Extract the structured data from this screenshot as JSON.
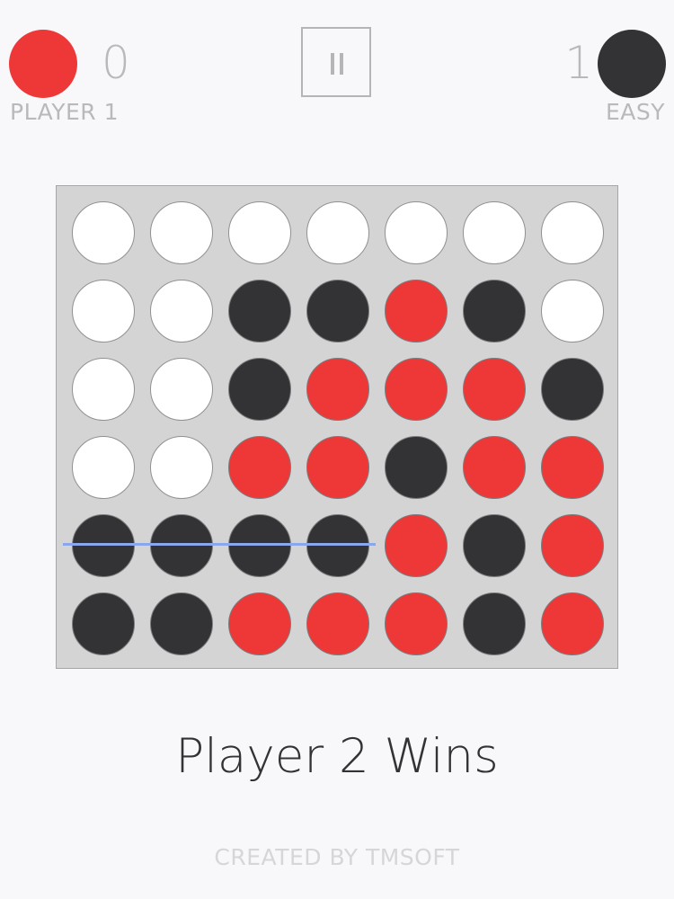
{
  "header": {
    "player1": {
      "label": "PLAYER 1",
      "score": "0",
      "disc_color": "#ee3838"
    },
    "player2": {
      "label": "EASY",
      "score": "1",
      "disc_color": "#333336"
    },
    "pause_icon": "pause-icon"
  },
  "board": {
    "columns": 7,
    "rows": 6,
    "grid": [
      [
        "empty",
        "empty",
        "empty",
        "empty",
        "empty",
        "empty",
        "empty"
      ],
      [
        "empty",
        "empty",
        "black",
        "black",
        "red",
        "black",
        "empty"
      ],
      [
        "empty",
        "empty",
        "black",
        "red",
        "red",
        "red",
        "black"
      ],
      [
        "empty",
        "empty",
        "red",
        "red",
        "black",
        "red",
        "red"
      ],
      [
        "black",
        "black",
        "black",
        "black",
        "red",
        "black",
        "red"
      ],
      [
        "black",
        "black",
        "red",
        "red",
        "red",
        "black",
        "red"
      ]
    ],
    "winning_line": {
      "row": 5,
      "from_col": 1,
      "to_col": 4,
      "color": "#8aa6ec"
    }
  },
  "status": {
    "result": "Player 2 Wins"
  },
  "footer": {
    "credit": "CREATED BY TMSOFT"
  },
  "colors": {
    "red": "#ee3838",
    "black": "#333336",
    "empty": "#ffffff",
    "board": "#d4d4d5"
  }
}
